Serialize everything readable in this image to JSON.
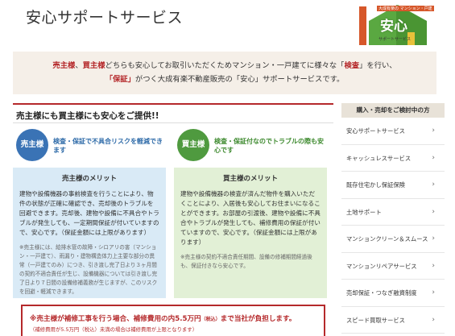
{
  "header": {
    "title": "安心サポートサービス",
    "logo": {
      "caption_top": "大成有楽の マンション・戸建",
      "text": "安心",
      "caption_bottom": "サポートサービス"
    }
  },
  "intro": {
    "seller": "売主様",
    "sep": "、",
    "buyer": "買主様",
    "text1": "どちらも安心してお取引いただくためマンション・一戸建てに様々な「",
    "inspection": "検査",
    "text2": "」を行い、",
    "warranty": "「保証」",
    "text3": "がつく大成有楽不動産販売の「安心」サポートサービスです。"
  },
  "main": {
    "heading": "売主様にも買主様にも安心をご提供!!",
    "seller": {
      "role": "売主様",
      "tagline": "検査・保証で不具合リスクを軽減できます",
      "merit_title": "売主様のメリット",
      "merit_body": "建物や設備機器の事前検査を行うことにより、物件の状態が正確に確認でき、売却後のトラブルを回避できます。売却後、建物や設備に不具合やトラブルが発生しても、一定期間保証が付いていますので、安心です。（保証金額には上限があります）",
      "merit_note": "※売主様には、給排水管の故障・シロアリの害（マンション・一戸建て）、雨漏り・建物構造体力上主要な部分の異常（一戸建てのみ）につき、引き渡し完了日より３ヶ月間の契約不適合責任が生じ、設備機器については引き渡し完了日より７日間の設備修補義務が生じますが、このリスクを回避・軽減できます。"
    },
    "buyer": {
      "role": "買主様",
      "tagline": "検査・保証付なのでトラブルの際も安心です",
      "merit_title": "買主様のメリット",
      "merit_body": "建物や設備機器の検査が済んだ物件を購入いただくことにより、入居後も安心してお住まいになることができます。お部屋の引渡後、建物や設備に不具合やトラブルが発生しても、補修費用の保証が付いていますので、安心です。（保証金額には上限があります）",
      "merit_note": "※売主様の契約不適合責任期間、設備の修補期間経過後も、保証付きなら安心です。"
    },
    "warranty_note": {
      "main": "※売主様が補修工事を行う場合、補修費用の内5.5万円",
      "main_small": "（税込）",
      "main_end": "まで当社が負担します。",
      "sub": "（補修費用が5.5万円",
      "sub_small": "（税込）",
      "sub_end": "未満の場合は補修費用が上限となります）"
    }
  },
  "sidebar": {
    "heading": "購入・売却をご検討中の方",
    "items": [
      {
        "label": "安心サポートサービス"
      },
      {
        "label": "キャッシュレスサービス"
      },
      {
        "label": "既存住宅かし保証保険"
      },
      {
        "label": "土地サポート"
      },
      {
        "label": "マンションクリーン＆スムース"
      },
      {
        "label": "マンションリペアサービス"
      },
      {
        "label": "売却保証・つなぎ融資制度"
      },
      {
        "label": "スピード買取サービス"
      }
    ]
  },
  "colors": {
    "accent_red": "#b5292b",
    "seller_blue": "#3a73b5",
    "buyer_green": "#4f9a3f",
    "intro_bg": "#f5efe8",
    "seller_box": "#d9eaf6",
    "buyer_box": "#e2f0d6"
  },
  "icons": {
    "logo": "house-logo-icon",
    "sidebar_chevron": "chevron-right-icon"
  }
}
